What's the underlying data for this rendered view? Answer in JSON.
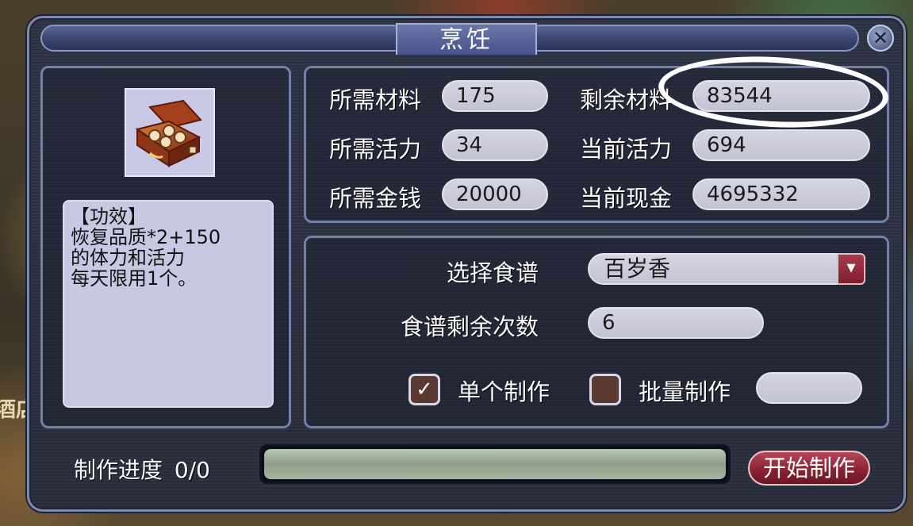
{
  "scene": {
    "left_sign": "酒店"
  },
  "dialog": {
    "title": "烹饪",
    "close_glyph": "✕"
  },
  "item": {
    "description_lines": [
      "【功效】",
      "恢复品质*2+150",
      "的体力和活力",
      "每天限用1个。"
    ]
  },
  "stats": {
    "required_material_label": "所需材料",
    "required_material_value": "175",
    "remaining_material_label": "剩余材料",
    "remaining_material_value": "83544",
    "required_vitality_label": "所需活力",
    "required_vitality_value": "34",
    "current_vitality_label": "当前活力",
    "current_vitality_value": "694",
    "required_money_label": "所需金钱",
    "required_money_value": "20000",
    "current_cash_label": "当前现金",
    "current_cash_value": "4695332"
  },
  "recipe": {
    "select_label": "选择食谱",
    "selected_recipe": "百岁香",
    "remaining_uses_label": "食谱剩余次数",
    "remaining_uses_value": "6",
    "single_label": "单个制作",
    "single_checked": true,
    "batch_label": "批量制作",
    "batch_checked": false,
    "batch_quantity": ""
  },
  "progress": {
    "label": "制作进度",
    "value_text": "0/0",
    "fraction": 0
  },
  "start_button_label": "开始制作",
  "icons": {
    "dropdown": "chevron-down-icon",
    "check": "✓",
    "item": "food-box-icon"
  }
}
